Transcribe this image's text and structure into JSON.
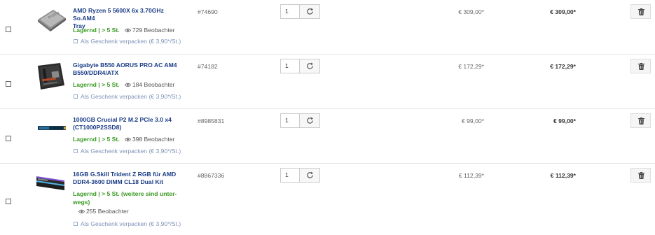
{
  "cart": {
    "items": [
      {
        "title_line1": "AMD Ryzen 5 5600X 6x 3.70GHz So.AM4",
        "title_line2": "Tray",
        "stock_label": "Lagernd",
        "stock_detail": " | > 5 St.",
        "watchers": "729 Beobachter",
        "gift": "Als Geschenk verpacken (€ 3,90*/St.)",
        "sku": "#74690",
        "qty": "1",
        "price": "€ 309,00*",
        "total": "€ 309,00*",
        "image": "cpu-image"
      },
      {
        "title_line1": "Gigabyte B550 AORUS PRO AC AM4",
        "title_line2": "B550/DDR4/ATX",
        "stock_label": "Lagernd",
        "stock_detail": " | > 5 St.",
        "watchers": "184 Beobachter",
        "gift": "Als Geschenk verpacken (€ 3,90*/St.)",
        "sku": "#74182",
        "qty": "1",
        "price": "€ 172,29*",
        "total": "€ 172,29*",
        "image": "motherboard-image"
      },
      {
        "title_line1": "1000GB Crucial P2 M.2 PCIe 3.0 x4",
        "title_line2": "(CT1000P2SSD8)",
        "stock_label": "Lagernd",
        "stock_detail": " | > 5 St.",
        "watchers": "398 Beobachter",
        "gift": "Als Geschenk verpacken (€ 3,90*/St.)",
        "sku": "#8985831",
        "qty": "1",
        "price": "€ 99,00*",
        "total": "€ 99,00*",
        "image": "ssd-image"
      },
      {
        "title_line1": "16GB G.Skill Trident Z RGB für AMD",
        "title_line2": "DDR4-3600 DIMM CL18 Dual Kit",
        "stock_label": "Lagernd",
        "stock_detail": " | > 5 St. (weitere sind unter-",
        "stock_detail2": "wegs)",
        "watchers": "255 Beobachter",
        "gift": "Als Geschenk verpacken (€ 3,90*/St.)",
        "sku": "#8867336",
        "qty": "1",
        "price": "€ 112,39*",
        "total": "€ 112,39*",
        "image": "ram-image"
      }
    ]
  },
  "colors": {
    "title": "#1a3c87",
    "stock": "#3a9a23",
    "gift": "#7e93b8"
  },
  "icons": [
    "checkbox",
    "eye-icon",
    "refresh-icon",
    "trash-icon",
    "gift-checkbox"
  ]
}
